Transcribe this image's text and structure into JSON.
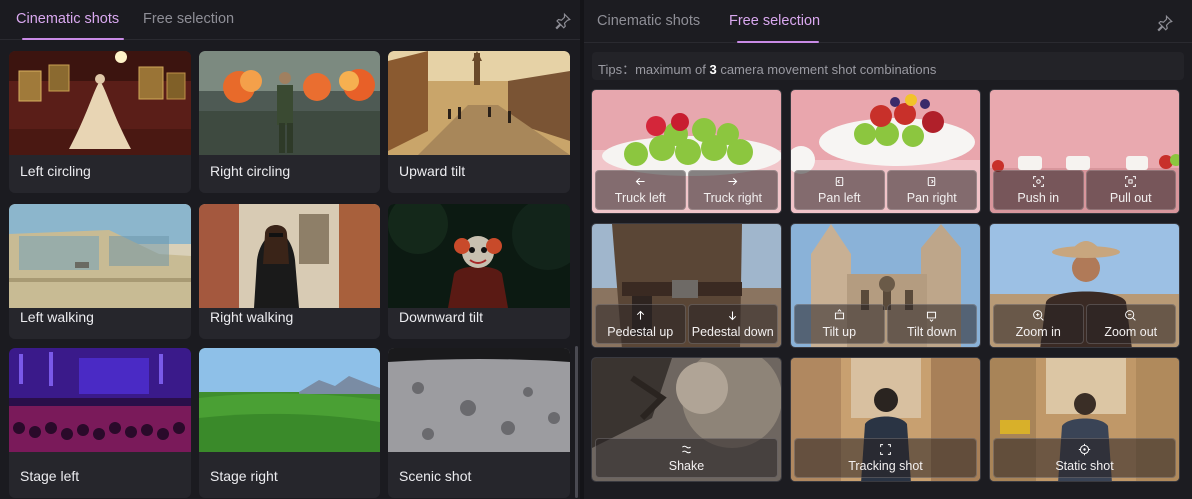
{
  "left": {
    "tabs": [
      "Cinematic shots",
      "Free selection"
    ],
    "cards": [
      {
        "label": "Left circling"
      },
      {
        "label": "Right circling"
      },
      {
        "label": "Upward tilt"
      },
      {
        "label": "Left walking"
      },
      {
        "label": "Right walking"
      },
      {
        "label": "Downward tilt"
      },
      {
        "label": "Stage left"
      },
      {
        "label": "Stage right"
      },
      {
        "label": "Scenic shot"
      }
    ]
  },
  "right": {
    "tabs": [
      "Cinematic shots",
      "Free selection"
    ],
    "tips": {
      "prefix": "Tips：maximum of ",
      "count": "3",
      "suffix": " camera movement shot combinations"
    },
    "shots": [
      {
        "buttons": [
          {
            "label": "Truck left",
            "icon": "arrow-left-icon"
          },
          {
            "label": "Truck right",
            "icon": "arrow-right-icon"
          }
        ]
      },
      {
        "buttons": [
          {
            "label": "Pan left",
            "icon": "pan-left-icon"
          },
          {
            "label": "Pan right",
            "icon": "pan-right-icon"
          }
        ]
      },
      {
        "buttons": [
          {
            "label": "Push in",
            "icon": "push-in-icon"
          },
          {
            "label": "Pull out",
            "icon": "pull-out-icon"
          }
        ]
      },
      {
        "buttons": [
          {
            "label": "Pedestal up",
            "icon": "arrow-up-icon"
          },
          {
            "label": "Pedestal down",
            "icon": "arrow-down-icon"
          }
        ]
      },
      {
        "buttons": [
          {
            "label": "Tilt up",
            "icon": "tilt-up-icon"
          },
          {
            "label": "Tilt down",
            "icon": "tilt-down-icon"
          }
        ]
      },
      {
        "buttons": [
          {
            "label": "Zoom in",
            "icon": "zoom-in-icon"
          },
          {
            "label": "Zoom out",
            "icon": "zoom-out-icon"
          }
        ]
      },
      {
        "buttons": [
          {
            "label": "Shake",
            "icon": "shake-icon"
          }
        ]
      },
      {
        "buttons": [
          {
            "label": "Tracking shot",
            "icon": "tracking-icon"
          }
        ]
      },
      {
        "buttons": [
          {
            "label": "Static shot",
            "icon": "crosshair-icon"
          }
        ]
      }
    ]
  },
  "colors": {
    "accent": "#d9a8ef",
    "background": "#1b1b20"
  }
}
